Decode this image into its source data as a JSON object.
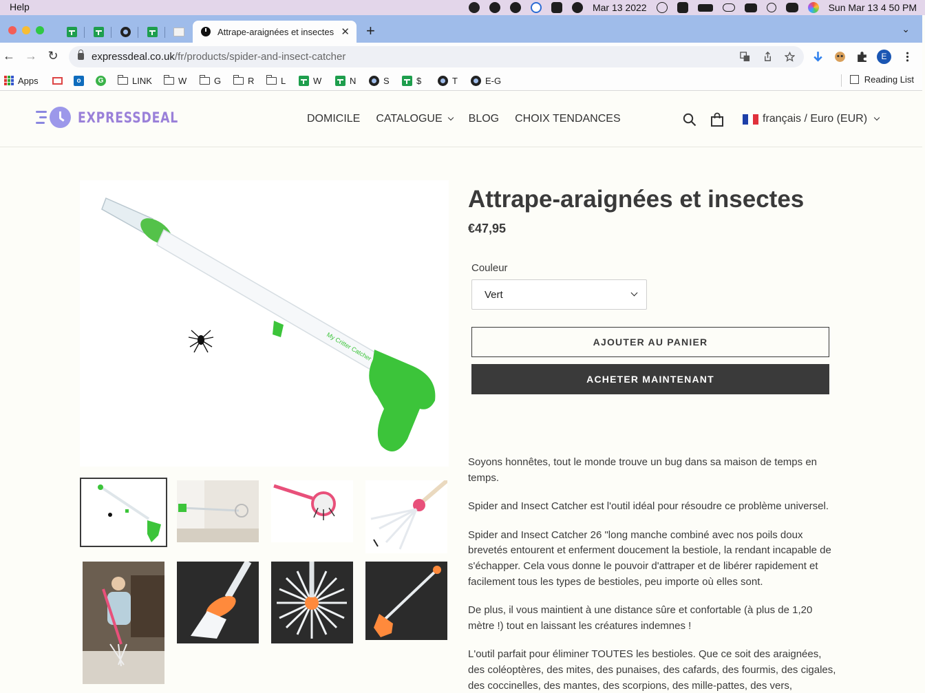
{
  "menubar": {
    "app_menu": "Help",
    "date": "Mar 13 2022",
    "datetime": "Sun Mar 13  4 50 PM"
  },
  "browser": {
    "active_tab_title": "Attrape-araignées et insectes",
    "url_host": "expressdeal.co.uk",
    "url_path": "/fr/products/spider-and-insect-catcher",
    "profile_initial": "E",
    "bookmarks": [
      "Apps",
      "LINK",
      "W",
      "G",
      "R",
      "L",
      "W",
      "N",
      "S",
      "$",
      "T",
      "E-G"
    ],
    "reading_list": "Reading List"
  },
  "site": {
    "logo_text": "EXPRESSDEAL",
    "nav": [
      "DOMICILE",
      "CATALOGUE",
      "BLOG",
      "CHOIX TENDANCES"
    ],
    "locale": "français / Euro (EUR)"
  },
  "product": {
    "title": "Attrape-araignées et insectes",
    "price": "€47,95",
    "option_label": "Couleur",
    "option_value": "Vert",
    "add_to_cart": "AJOUTER AU PANIER",
    "buy_now": "ACHETER MAINTENANT",
    "description": [
      "Soyons honnêtes, tout le monde trouve un bug dans sa maison de temps en temps.",
      "Spider and Insect Catcher est l'outil idéal pour résoudre ce problème universel.",
      "Spider and Insect Catcher 26 \"long manche combiné avec nos poils doux brevetés entourent et enferment doucement la bestiole, la rendant incapable de s'échapper. Cela vous donne le pouvoir d'attraper et de libérer rapidement et facilement tous les types de bestioles, peu importe où elles sont.",
      "De plus, il vous maintient à une distance sûre et confortable (à plus de 1,20 mètre !) tout en laissant les créatures indemnes !",
      "L'outil parfait pour éliminer TOUTES les bestioles. Que ce soit des araignées, des coléoptères, des mites, des punaises, des cafards, des fourmis, des cigales, des coccinelles, des mantes, des scorpions, des mille-pattes, des vers,"
    ],
    "product_image_text": "My Critter Catcher"
  },
  "colors": {
    "accent_green": "#3cc43a",
    "button_dark": "#3a3a3a",
    "logo_purple": "#9a80d9",
    "tabstrip_blue": "#9fbcea"
  }
}
